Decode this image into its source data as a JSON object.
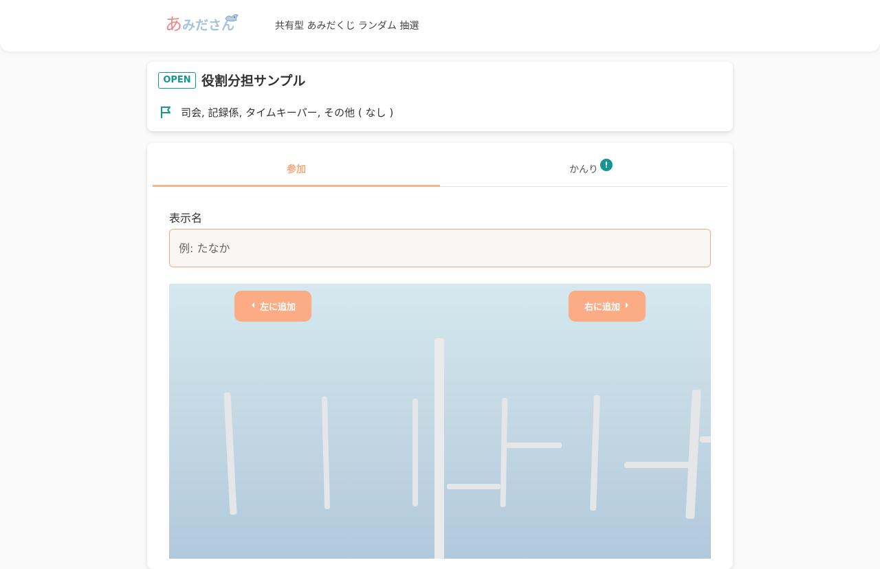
{
  "header": {
    "logo_first": "あ",
    "logo_rest": "みださん",
    "tagline": "共有型 あみだくじ ランダム 抽選"
  },
  "info": {
    "status_badge": "OPEN",
    "title": "役割分担サンプル",
    "roles": "司会, 記録係, タイムキーパー, その他 ( なし )"
  },
  "tabs": {
    "join": "参加",
    "admin": "かんり",
    "admin_alert": "!"
  },
  "form": {
    "name_label": "表示名",
    "name_placeholder": "例: たなか",
    "name_value": ""
  },
  "stage": {
    "add_left": "左に追加",
    "add_right": "右に追加"
  },
  "colors": {
    "accent_orange": "#fcac84",
    "teal": "#15968f",
    "logo_pink": "#e78a8a",
    "logo_blue": "#a9c2dc"
  },
  "icons": [
    "bird-icon",
    "flag-icon",
    "caret-left-icon",
    "caret-right-icon"
  ]
}
